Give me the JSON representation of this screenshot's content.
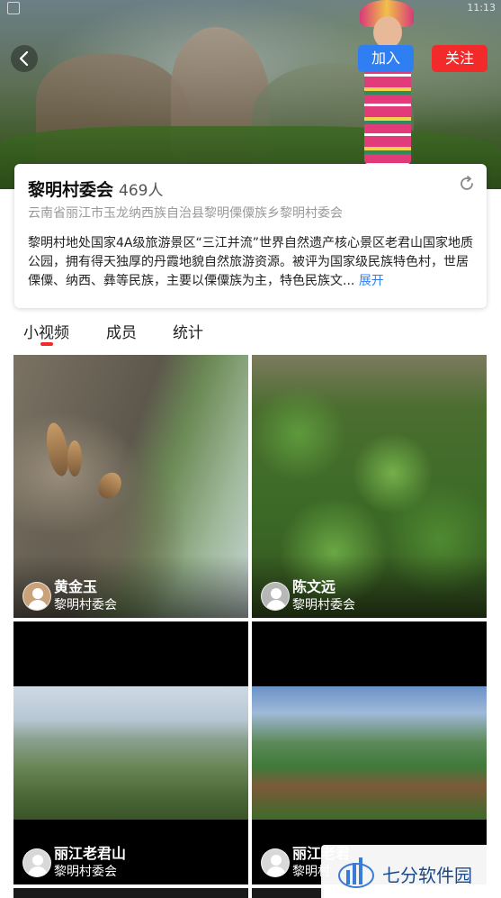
{
  "status_bar": {
    "time": "11:13"
  },
  "header": {
    "join_label": "加入",
    "follow_label": "关注"
  },
  "org": {
    "name": "黎明村委会",
    "member_count": "469人",
    "address": "云南省丽江市玉龙纳西族自治县黎明傈僳族乡黎明村委会",
    "description": "黎明村地处国家4A级旅游景区“三江并流”世界自然遗产核心景区老君山国家地质公园，拥有得天独厚的丹霞地貌自然旅游资源。被评为国家级民族特色村，世居傈僳、纳西、彝等民族，主要以傈僳族为主，特色民族文...",
    "expand_label": "展开"
  },
  "tabs": [
    {
      "label": "小视频",
      "active": true
    },
    {
      "label": "成员",
      "active": false
    },
    {
      "label": "统计",
      "active": false
    }
  ],
  "videos": [
    {
      "author": "黄金玉",
      "org": "黎明村委会",
      "scene": "cliff-beehives"
    },
    {
      "author": "陈文远",
      "org": "黎明村委会",
      "scene": "green-crops"
    },
    {
      "author": "丽江老君山",
      "org": "黎明村委会",
      "scene": "mountain-valley"
    },
    {
      "author": "丽江老君",
      "org": "黎明村",
      "scene": "mountain-valley-2"
    }
  ],
  "watermark": {
    "text": "七分软件园"
  },
  "colors": {
    "join": "#2f7ff2",
    "follow": "#f22a2a",
    "link": "#2f7ff2",
    "tab_indicator": "#f22a2a"
  }
}
